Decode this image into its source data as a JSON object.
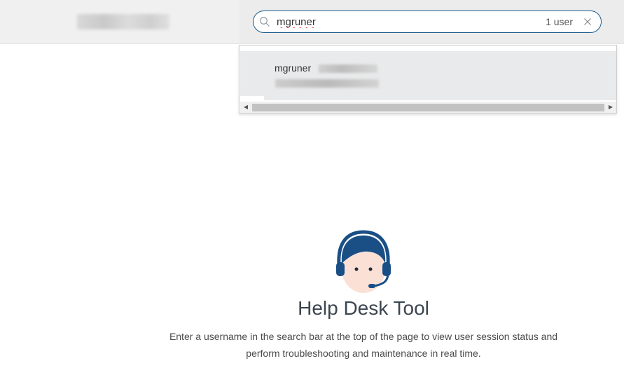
{
  "header": {
    "search": {
      "value": "mgruner",
      "result_count": "1 user"
    }
  },
  "dropdown": {
    "results": [
      {
        "username": "mgruner"
      }
    ]
  },
  "empty_state": {
    "title": "Help Desk Tool",
    "description": "Enter a username in the search bar at the top of the page to view user session status and perform troubleshooting and maintenance in real time."
  },
  "colors": {
    "accent": "#1c5e8e",
    "avatar_hair": "#1a4f86",
    "avatar_skin": "#fbe0d6"
  }
}
